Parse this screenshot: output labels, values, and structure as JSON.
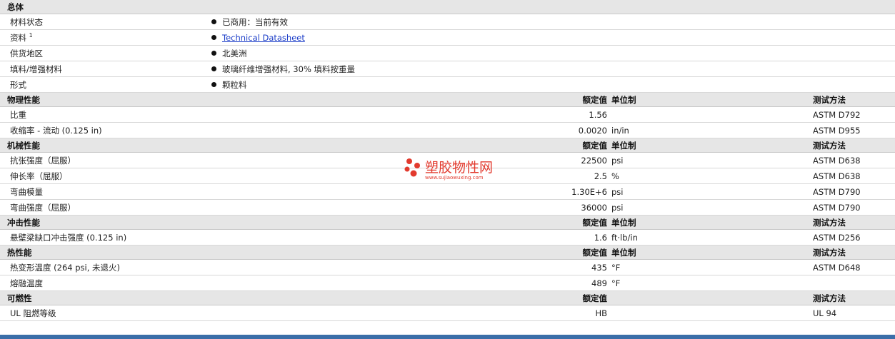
{
  "general": {
    "header": "总体",
    "rows": [
      {
        "label": "材料状态",
        "value": "已商用：当前有效"
      },
      {
        "label": "资料",
        "sup": "1",
        "value": "Technical Datasheet"
      },
      {
        "label": "供货地区",
        "value": "北美洲"
      },
      {
        "label": "填料/增强材料",
        "value": "玻璃纤维增强材料, 30% 填料按重量"
      },
      {
        "label": "形式",
        "value": "颗粒料"
      }
    ]
  },
  "sections": [
    {
      "title": "物理性能",
      "col_value": "额定值",
      "col_unit": "单位制",
      "col_test": "测试方法",
      "rows": [
        {
          "label": "比重",
          "value": "1.56",
          "unit": "",
          "test": "ASTM D792"
        },
        {
          "label": "收缩率 - 流动 (0.125 in)",
          "value": "0.0020",
          "unit": "in/in",
          "test": "ASTM D955"
        }
      ]
    },
    {
      "title": "机械性能",
      "col_value": "额定值",
      "col_unit": "单位制",
      "col_test": "测试方法",
      "rows": [
        {
          "label": "抗张强度（屈服）",
          "value": "22500",
          "unit": "psi",
          "test": "ASTM D638"
        },
        {
          "label": "伸长率（屈服）",
          "value": "2.5",
          "unit": "%",
          "test": "ASTM D638"
        },
        {
          "label": "弯曲模量",
          "value": "1.30E+6",
          "unit": "psi",
          "test": "ASTM D790"
        },
        {
          "label": "弯曲强度（屈服）",
          "value": "36000",
          "unit": "psi",
          "test": "ASTM D790"
        }
      ]
    },
    {
      "title": "冲击性能",
      "col_value": "额定值",
      "col_unit": "单位制",
      "col_test": "测试方法",
      "rows": [
        {
          "label": "悬壁梁缺口冲击强度 (0.125 in)",
          "value": "1.6",
          "unit": "ft·lb/in",
          "test": "ASTM D256"
        }
      ]
    },
    {
      "title": "热性能",
      "col_value": "额定值",
      "col_unit": "单位制",
      "col_test": "测试方法",
      "rows": [
        {
          "label": "热变形温度 (264 psi, 未退火)",
          "value": "435",
          "unit": "°F",
          "test": "ASTM D648"
        },
        {
          "label": "熔融温度",
          "value": "489",
          "unit": "°F",
          "test": ""
        }
      ]
    },
    {
      "title": "可燃性",
      "col_value": "额定值",
      "col_unit": "",
      "col_test": "测试方法",
      "rows": [
        {
          "label": "UL 阻燃等级",
          "value": "HB",
          "unit": "",
          "test": "UL 94"
        }
      ]
    }
  ],
  "watermark": {
    "text": "塑胶物性网",
    "url": "www.sujiaowuxing.com",
    "color": "#e23a2e"
  }
}
